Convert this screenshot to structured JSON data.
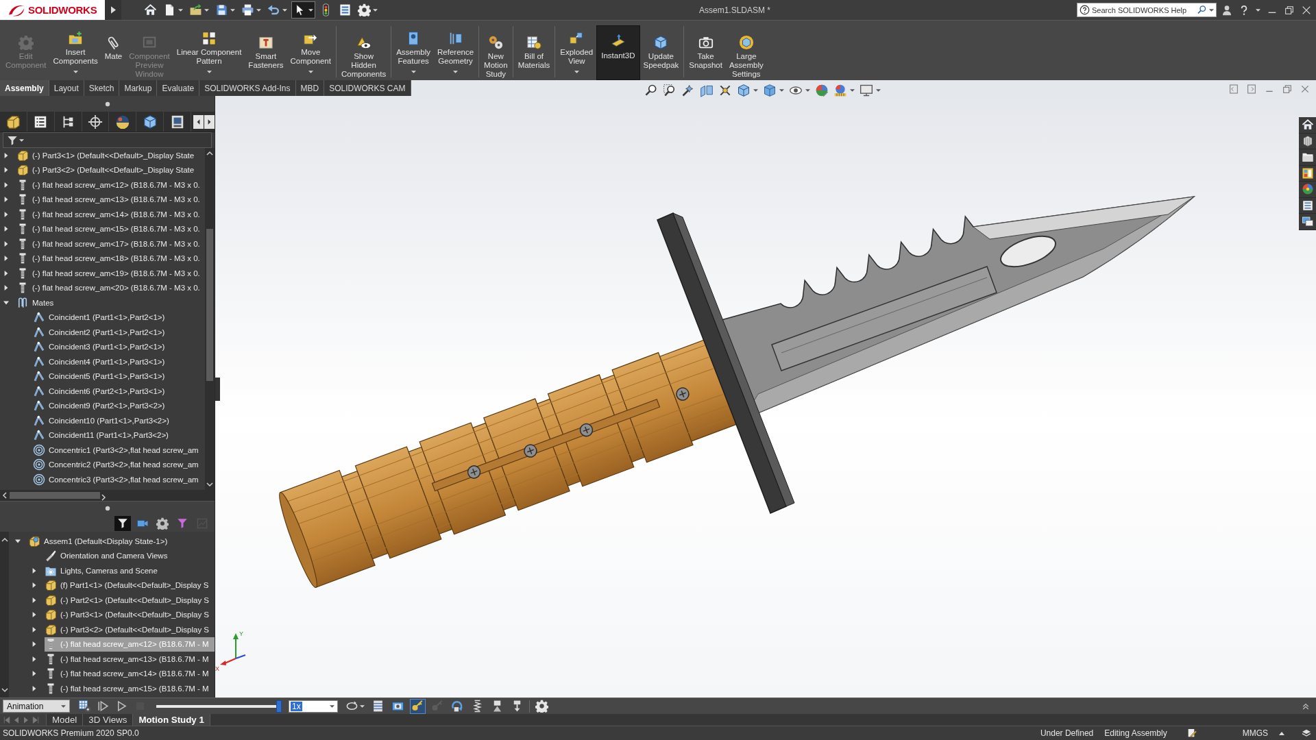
{
  "window": {
    "logo": "SOLIDWORKS",
    "title": "Assem1.SLDASM *"
  },
  "help_search": {
    "placeholder": "Search SOLIDWORKS Help"
  },
  "quick_access": [
    {
      "kind": "home",
      "on": false
    },
    {
      "kind": "new",
      "on": false
    },
    {
      "kind": "open",
      "on": false
    },
    {
      "kind": "save",
      "on": false
    },
    {
      "kind": "print",
      "on": false
    },
    {
      "kind": "undo",
      "on": false
    },
    {
      "kind": "select",
      "on": true
    },
    {
      "kind": "rebuild",
      "on": false
    },
    {
      "kind": "file-properties",
      "on": false
    },
    {
      "kind": "options",
      "on": false
    }
  ],
  "command_manager": [
    [
      {
        "kind": "edit-component",
        "label": "Edit\nComponent",
        "disabled": true,
        "on": false
      },
      {
        "kind": "insert-components",
        "label": "Insert\nComponents",
        "disabled": false,
        "on": false
      },
      {
        "kind": "mate",
        "label": "Mate",
        "disabled": false,
        "on": false
      },
      {
        "kind": "preview-window",
        "label": "Component\nPreview\nWindow",
        "disabled": true,
        "on": false
      },
      {
        "kind": "linear-pattern",
        "label": "Linear Component\nPattern",
        "disabled": false,
        "on": false
      },
      {
        "kind": "smart-fasteners",
        "label": "Smart\nFasteners",
        "disabled": false,
        "on": false
      },
      {
        "kind": "move-component",
        "label": "Move\nComponent",
        "disabled": false,
        "on": false
      }
    ],
    [
      {
        "kind": "show-hidden",
        "label": "Show\nHidden\nComponents",
        "disabled": false,
        "on": false
      }
    ],
    [
      {
        "kind": "assembly-features",
        "label": "Assembly\nFeatures",
        "disabled": false,
        "on": false
      },
      {
        "kind": "reference-geometry",
        "label": "Reference\nGeometry",
        "disabled": false,
        "on": false
      }
    ],
    [
      {
        "kind": "motion-study",
        "label": "New\nMotion\nStudy",
        "disabled": false,
        "on": false
      }
    ],
    [
      {
        "kind": "bom",
        "label": "Bill of\nMaterials",
        "disabled": false,
        "on": false
      }
    ],
    [
      {
        "kind": "exploded-view",
        "label": "Exploded\nView",
        "disabled": false,
        "on": false
      },
      {
        "kind": "instant3d",
        "label": "Instant3D",
        "disabled": false,
        "on": true
      },
      {
        "kind": "speedpak",
        "label": "Update\nSpeedpak",
        "disabled": false,
        "on": false
      }
    ],
    [
      {
        "kind": "snapshot",
        "label": "Take\nSnapshot",
        "disabled": false,
        "on": false
      },
      {
        "kind": "large-assembly",
        "label": "Large\nAssembly\nSettings",
        "disabled": false,
        "on": false
      }
    ]
  ],
  "tabs": [
    {
      "label": "Assembly",
      "selected": true
    },
    {
      "label": "Layout",
      "selected": false
    },
    {
      "label": "Sketch",
      "selected": false
    },
    {
      "label": "Markup",
      "selected": false
    },
    {
      "label": "Evaluate",
      "selected": false
    },
    {
      "label": "SOLIDWORKS Add-Ins",
      "selected": false
    },
    {
      "label": "MBD",
      "selected": false
    },
    {
      "label": "SOLIDWORKS CAM",
      "selected": false
    }
  ],
  "feature_tree": [
    {
      "kind": "part",
      "label": "(-) Part3<1> (Default<<Default>_Display State",
      "expanded": false,
      "selected": false
    },
    {
      "kind": "part",
      "label": "(-) Part3<2> (Default<<Default>_Display State",
      "expanded": false,
      "selected": false
    },
    {
      "kind": "screw",
      "label": "(-) flat head screw_am<12> (B18.6.7M - M3 x 0.",
      "expanded": false,
      "selected": false
    },
    {
      "kind": "screw",
      "label": "(-) flat head screw_am<13> (B18.6.7M - M3 x 0.",
      "expanded": false,
      "selected": false
    },
    {
      "kind": "screw",
      "label": "(-) flat head screw_am<14> (B18.6.7M - M3 x 0.",
      "expanded": false,
      "selected": false
    },
    {
      "kind": "screw",
      "label": "(-) flat head screw_am<15> (B18.6.7M - M3 x 0.",
      "expanded": false,
      "selected": false
    },
    {
      "kind": "screw",
      "label": "(-) flat head screw_am<17> (B18.6.7M - M3 x 0.",
      "expanded": false,
      "selected": false
    },
    {
      "kind": "screw",
      "label": "(-) flat head screw_am<18> (B18.6.7M - M3 x 0.",
      "expanded": false,
      "selected": false
    },
    {
      "kind": "screw",
      "label": "(-) flat head screw_am<19> (B18.6.7M - M3 x 0.",
      "expanded": false,
      "selected": false
    },
    {
      "kind": "screw",
      "label": "(-) flat head screw_am<20> (B18.6.7M - M3 x 0.",
      "expanded": false,
      "selected": false
    },
    {
      "kind": "mates",
      "label": "Mates",
      "expanded": true,
      "selected": false,
      "children": [
        {
          "kind": "coincident",
          "label": "Coincident1 (Part1<1>,Part2<1>)",
          "selected": false
        },
        {
          "kind": "coincident",
          "label": "Coincident2 (Part1<1>,Part2<1>)",
          "selected": false
        },
        {
          "kind": "coincident",
          "label": "Coincident3 (Part1<1>,Part2<1>)",
          "selected": false
        },
        {
          "kind": "coincident",
          "label": "Coincident4 (Part1<1>,Part3<1>)",
          "selected": false
        },
        {
          "kind": "coincident",
          "label": "Coincident5 (Part1<1>,Part3<1>)",
          "selected": false
        },
        {
          "kind": "coincident",
          "label": "Coincident6 (Part2<1>,Part3<1>)",
          "selected": false
        },
        {
          "kind": "coincident",
          "label": "Coincident9 (Part2<1>,Part3<2>)",
          "selected": false
        },
        {
          "kind": "coincident",
          "label": "Coincident10 (Part1<1>,Part3<2>)",
          "selected": false
        },
        {
          "kind": "coincident",
          "label": "Coincident11 (Part1<1>,Part3<2>)",
          "selected": false
        },
        {
          "kind": "concentric",
          "label": "Concentric1 (Part3<2>,flat head screw_am",
          "selected": false
        },
        {
          "kind": "concentric",
          "label": "Concentric2 (Part3<2>,flat head screw_am",
          "selected": false
        },
        {
          "kind": "concentric",
          "label": "Concentric3 (Part3<2>,flat head screw_am",
          "selected": false
        }
      ]
    }
  ],
  "motion_tree": {
    "toolbar": [
      {
        "kind": "filter",
        "on": true,
        "disabled": false
      },
      {
        "kind": "camera",
        "on": false,
        "disabled": false
      },
      {
        "kind": "gear-filter",
        "on": false,
        "disabled": false
      },
      {
        "kind": "funnel",
        "on": false,
        "disabled": false
      },
      {
        "kind": "chart",
        "on": false,
        "disabled": true
      }
    ],
    "items": [
      {
        "kind": "assembly",
        "label": "Assem1 (Default<Display State-1>)",
        "expanded": true,
        "selected": false,
        "children": [
          {
            "kind": "camera-views",
            "label": "Orientation and Camera Views",
            "selected": false
          },
          {
            "kind": "lights",
            "label": "Lights, Cameras and Scene",
            "expanded": false,
            "selected": false
          },
          {
            "kind": "part",
            "label": "(f) Part1<1> (Default<<Default>_Display S",
            "expanded": false,
            "selected": false
          },
          {
            "kind": "part",
            "label": "(-) Part2<1> (Default<<Default>_Display S",
            "expanded": false,
            "selected": false
          },
          {
            "kind": "part",
            "label": "(-) Part3<1> (Default<<Default>_Display S",
            "expanded": false,
            "selected": false
          },
          {
            "kind": "part",
            "label": "(-) Part3<2> (Default<<Default>_Display S",
            "expanded": false,
            "selected": false
          },
          {
            "kind": "screw",
            "label": "(-) flat head screw_am<12> (B18.6.7M - M",
            "expanded": false,
            "selected": true
          },
          {
            "kind": "screw",
            "label": "(-) flat head screw_am<13> (B18.6.7M - M",
            "expanded": false,
            "selected": false
          },
          {
            "kind": "screw",
            "label": "(-) flat head screw_am<14> (B18.6.7M - M",
            "expanded": false,
            "selected": false
          },
          {
            "kind": "screw",
            "label": "(-) flat head screw_am<15> (B18.6.7M - M",
            "expanded": false,
            "selected": false
          }
        ]
      }
    ]
  },
  "triad": {
    "y_axis": "Y",
    "x_axis": "X"
  },
  "motion_study": {
    "study_type": "Animation",
    "controls": [
      {
        "kind": "calculate",
        "disabled": false
      },
      {
        "kind": "play-from-start",
        "disabled": false
      },
      {
        "kind": "play",
        "disabled": false
      },
      {
        "kind": "stop",
        "disabled": true
      }
    ],
    "timeline": {
      "level": 1
    },
    "speed": "1x",
    "tools": [
      {
        "kind": "playback-mode",
        "on": false,
        "disabled": false
      },
      {
        "kind": "save-animation",
        "on": false,
        "disabled": false
      },
      {
        "kind": "wizard",
        "on": false,
        "disabled": false
      },
      {
        "kind": "autokey",
        "on": true,
        "disabled": false
      },
      {
        "kind": "add-key",
        "on": false,
        "disabled": true
      },
      {
        "kind": "motor",
        "on": false,
        "disabled": false
      },
      {
        "kind": "spring",
        "on": false,
        "disabled": false
      },
      {
        "kind": "contact",
        "on": false,
        "disabled": false
      },
      {
        "kind": "gravity",
        "on": false,
        "disabled": false
      },
      {
        "kind": "settings",
        "on": false,
        "disabled": false
      }
    ]
  },
  "study_tabs": [
    {
      "label": "Model",
      "selected": false
    },
    {
      "label": "3D Views",
      "selected": false
    },
    {
      "label": "Motion Study 1",
      "selected": true
    }
  ],
  "status_bar": {
    "product": "SOLIDWORKS Premium 2020 SP0.0",
    "states": [
      "Under Defined",
      "Editing Assembly"
    ],
    "units": "MMGS"
  }
}
